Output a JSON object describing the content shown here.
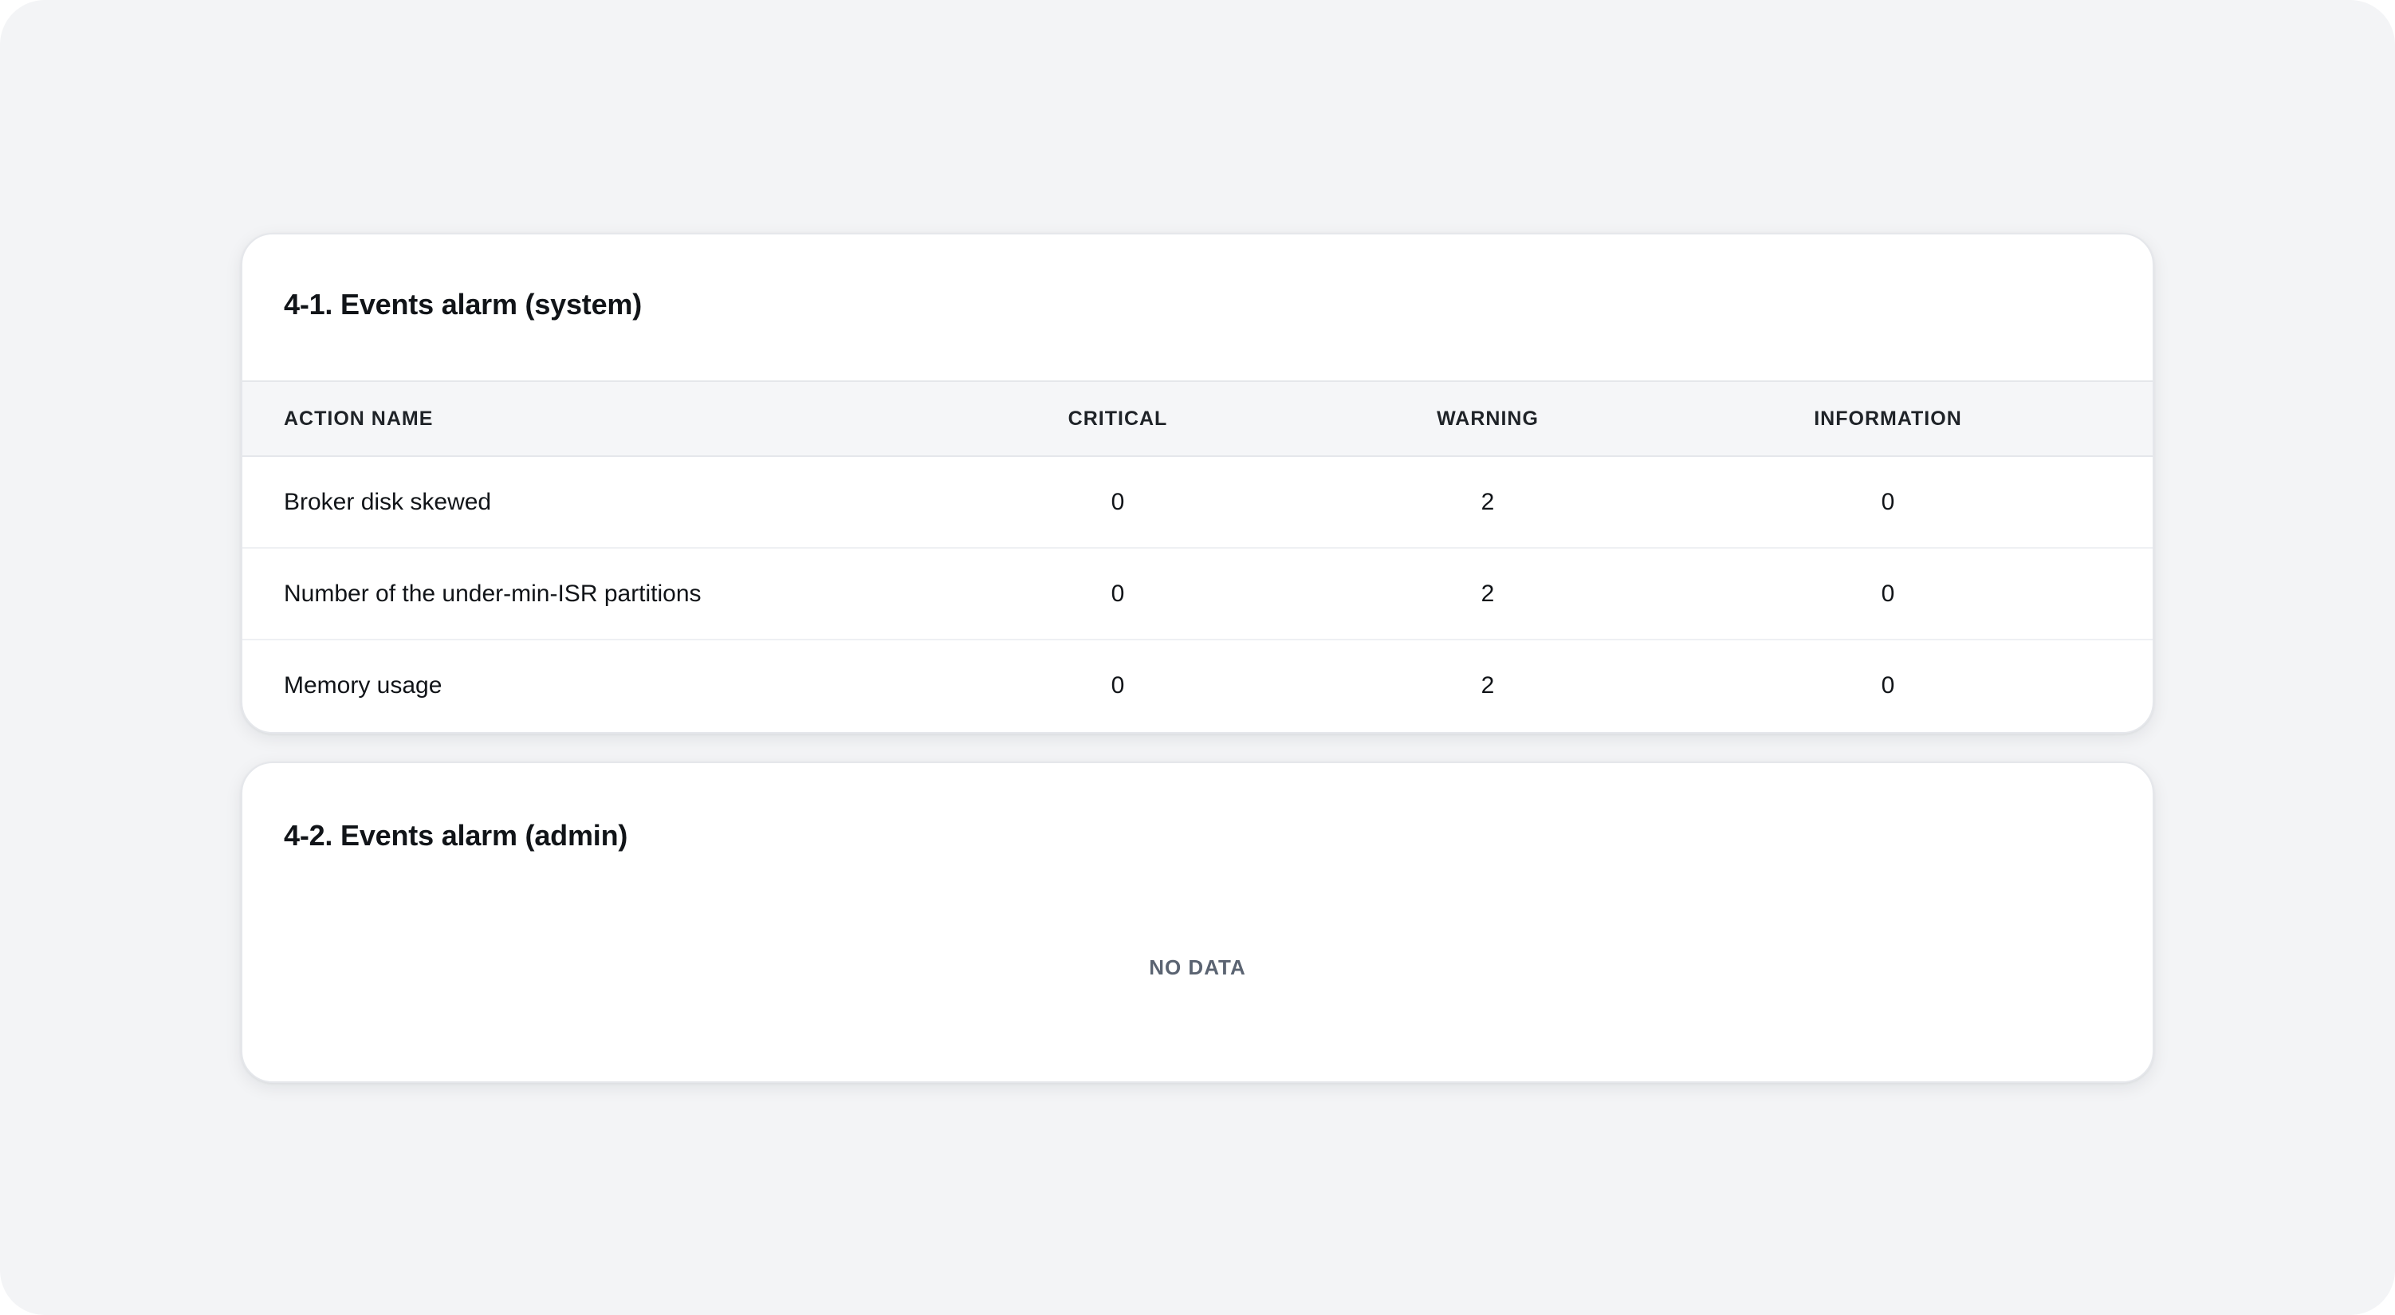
{
  "sections": {
    "system": {
      "title": "4-1. Events alarm (system)",
      "columns": {
        "action_name": "ACTION NAME",
        "critical": "CRITICAL",
        "warning": "WARNING",
        "information": "INFORMATION"
      },
      "rows": [
        {
          "action_name": "Broker disk skewed",
          "critical": "0",
          "warning": "2",
          "information": "0"
        },
        {
          "action_name": "Number of the under-min-ISR partitions",
          "critical": "0",
          "warning": "2",
          "information": "0"
        },
        {
          "action_name": "Memory usage",
          "critical": "0",
          "warning": "2",
          "information": "0"
        }
      ]
    },
    "admin": {
      "title": "4-2. Events alarm (admin)",
      "empty_text": "NO DATA"
    }
  }
}
